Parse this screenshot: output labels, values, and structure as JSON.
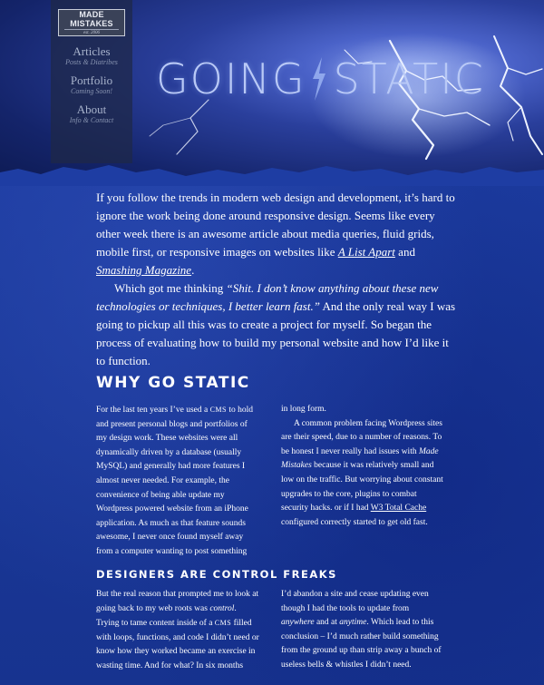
{
  "logo": {
    "name": "MADE MISTAKES",
    "est": "est. 2006"
  },
  "nav": [
    {
      "label": "Articles",
      "sub": "Posts & Diatribes"
    },
    {
      "label": "Portfolio",
      "sub": "Coming Soon!"
    },
    {
      "label": "About",
      "sub": "Info & Contact"
    }
  ],
  "hero": {
    "left": "GOING",
    "right": "STATIC"
  },
  "intro": {
    "p1_a": "If you follow the trends in modern web design and development, it’s hard to ignore the work being done around responsive design. Seems like every other week there is an awesome article about media queries, fluid grids, mobile first, or responsive images on websites like ",
    "link1": "A List Apart",
    "p1_b": " and ",
    "link2": "Smashing Magazine",
    "p1_c": ".",
    "p2_a": "Which got me thinking ",
    "p2_em": "“Shit. I don’t know anything about these new technologies or techniques, I better learn fast.”",
    "p2_b": " And the only real way I was going to pickup all this was to create a project for myself. So began the process of evaluating how to build my personal website and how I’d like it to function."
  },
  "section1": {
    "heading": "Why Go Static",
    "c1_a": "For the last ten years I’ve used a ",
    "c1_cms": "cms",
    "c1_b": " to hold and present personal blogs and portfolios of my design work. These websites were all dynamically driven by a database (usually MySQL) and generally had more features I almost never needed. For example, the convenience of being able update my Wordpress powered website from an iPhone application. As much as that feature sounds awesome, I never once found myself away from a computer wanting to post something",
    "c2_a": "in long form.",
    "c2_b1": "A common problem facing Wordpress sites are their speed, due to a number of reasons. To be honest I never really had issues with ",
    "c2_em": "Made Mistakes",
    "c2_b2": " because it was relatively small and low on the traffic. But worrying about constant upgrades to the core, plugins to combat security hacks. or if I had ",
    "c2_link": "W3 Total Cache",
    "c2_b3": " configured correctly started to get old fast."
  },
  "section2": {
    "heading": "Designers are Control Freaks",
    "c1_a": "But the real reason that prompted me to look at going back to my web roots was ",
    "c1_em": "control",
    "c1_b": ". Trying to tame content inside of a ",
    "c1_cms": "cms",
    "c1_c": " filled with loops, functions, and code I didn’t need or know how they worked became an exercise in wasting time. And for what? In six months",
    "c2_a": "I’d abandon a site and cease updating even though I had the tools to update from ",
    "c2_em1": "anywhere",
    "c2_b": " and at ",
    "c2_em2": "anytime",
    "c2_c": ". Which lead to this conclusion – I’d much rather build something from the ground up than strip away a bunch of useless bells & whistles I didn’t need."
  },
  "colors": {
    "background": "#1c3a9a",
    "title": "#b9c9f6",
    "text": "#ffffff"
  }
}
